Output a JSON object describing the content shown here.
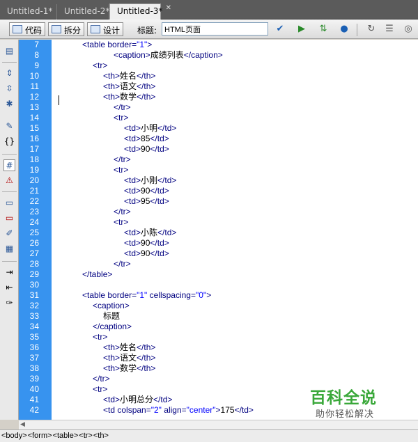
{
  "tabs": [
    {
      "label": "Untitled-1*"
    },
    {
      "label": "Untitled-2*"
    },
    {
      "label": "Untitled-3*"
    }
  ],
  "toolbar": {
    "code_label": "代码",
    "split_label": "拆分",
    "design_label": "设计",
    "title_label": "标题:",
    "title_value": "HTML页面"
  },
  "editor": {
    "line_numbers": [
      "7",
      "8",
      "9",
      "10",
      "11",
      "12",
      "13",
      "14",
      "15",
      "16",
      "17",
      "18",
      "19",
      "20",
      "21",
      "22",
      "23",
      "24",
      "25",
      "26",
      "27",
      "28",
      "29",
      "30",
      "31",
      "32",
      "33",
      "34",
      "35",
      "36",
      "37",
      "38",
      "39",
      "40",
      "41",
      "42"
    ],
    "lines": [
      {
        "indent": 3,
        "tokens": [
          [
            "tag",
            "<table "
          ],
          [
            "attr",
            "border="
          ],
          [
            "val",
            "\"1\""
          ],
          [
            "tag",
            ">"
          ]
        ]
      },
      {
        "indent": 6,
        "tokens": [
          [
            "tag",
            "<caption>"
          ],
          [
            "txt",
            "成绩列表"
          ],
          [
            "tag",
            "</caption>"
          ]
        ]
      },
      {
        "indent": 4,
        "tokens": [
          [
            "tag",
            "<tr>"
          ]
        ]
      },
      {
        "indent": 5,
        "tokens": [
          [
            "tag",
            "<th>"
          ],
          [
            "txt",
            "姓名"
          ],
          [
            "tag",
            "</th>"
          ]
        ]
      },
      {
        "indent": 5,
        "tokens": [
          [
            "tag",
            "<th>"
          ],
          [
            "txt",
            "语文"
          ],
          [
            "tag",
            "</th>"
          ]
        ]
      },
      {
        "indent": 5,
        "tokens": [
          [
            "tag",
            "<th>"
          ],
          [
            "txt",
            "数学"
          ],
          [
            "tag",
            "</th>"
          ]
        ]
      },
      {
        "indent": 6,
        "tokens": [
          [
            "tag",
            "</tr>"
          ]
        ]
      },
      {
        "indent": 6,
        "tokens": [
          [
            "tag",
            "<tr>"
          ]
        ]
      },
      {
        "indent": 7,
        "tokens": [
          [
            "tag",
            "<td>"
          ],
          [
            "txt",
            "小明"
          ],
          [
            "tag",
            "</td>"
          ]
        ]
      },
      {
        "indent": 7,
        "tokens": [
          [
            "tag",
            "<td>"
          ],
          [
            "txt",
            "85"
          ],
          [
            "tag",
            "</td>"
          ]
        ]
      },
      {
        "indent": 7,
        "tokens": [
          [
            "tag",
            "<td>"
          ],
          [
            "txt",
            "90"
          ],
          [
            "tag",
            "</td>"
          ]
        ]
      },
      {
        "indent": 6,
        "tokens": [
          [
            "tag",
            "</tr>"
          ]
        ]
      },
      {
        "indent": 6,
        "tokens": [
          [
            "tag",
            "<tr>"
          ]
        ]
      },
      {
        "indent": 7,
        "tokens": [
          [
            "tag",
            "<td>"
          ],
          [
            "txt",
            "小刚"
          ],
          [
            "tag",
            "</td>"
          ]
        ]
      },
      {
        "indent": 7,
        "tokens": [
          [
            "tag",
            "<td>"
          ],
          [
            "txt",
            "90"
          ],
          [
            "tag",
            "</td>"
          ]
        ]
      },
      {
        "indent": 7,
        "tokens": [
          [
            "tag",
            "<td>"
          ],
          [
            "txt",
            "95"
          ],
          [
            "tag",
            "</td>"
          ]
        ]
      },
      {
        "indent": 6,
        "tokens": [
          [
            "tag",
            "</tr>"
          ]
        ]
      },
      {
        "indent": 6,
        "tokens": [
          [
            "tag",
            "<tr>"
          ]
        ]
      },
      {
        "indent": 7,
        "tokens": [
          [
            "tag",
            "<td>"
          ],
          [
            "txt",
            "小陈"
          ],
          [
            "tag",
            "</td>"
          ]
        ]
      },
      {
        "indent": 7,
        "tokens": [
          [
            "tag",
            "<td>"
          ],
          [
            "txt",
            "90"
          ],
          [
            "tag",
            "</td>"
          ]
        ]
      },
      {
        "indent": 7,
        "tokens": [
          [
            "tag",
            "<td>"
          ],
          [
            "txt",
            "90"
          ],
          [
            "tag",
            "</td>"
          ]
        ]
      },
      {
        "indent": 6,
        "tokens": [
          [
            "tag",
            "</tr>"
          ]
        ]
      },
      {
        "indent": 3,
        "tokens": [
          [
            "tag",
            "</table>"
          ]
        ]
      },
      {
        "indent": 0,
        "tokens": []
      },
      {
        "indent": 3,
        "tokens": [
          [
            "tag",
            "<table "
          ],
          [
            "attr",
            "border="
          ],
          [
            "val",
            "\"1\""
          ],
          [
            "attr",
            " cellspacing="
          ],
          [
            "val",
            "\"0\""
          ],
          [
            "tag",
            ">"
          ]
        ]
      },
      {
        "indent": 4,
        "tokens": [
          [
            "tag",
            "<caption>"
          ]
        ]
      },
      {
        "indent": 5,
        "tokens": [
          [
            "txt",
            "标题"
          ]
        ]
      },
      {
        "indent": 4,
        "tokens": [
          [
            "tag",
            "</caption>"
          ]
        ]
      },
      {
        "indent": 4,
        "tokens": [
          [
            "tag",
            "<tr>"
          ]
        ]
      },
      {
        "indent": 5,
        "tokens": [
          [
            "tag",
            "<th>"
          ],
          [
            "txt",
            "姓名"
          ],
          [
            "tag",
            "</th>"
          ]
        ]
      },
      {
        "indent": 5,
        "tokens": [
          [
            "tag",
            "<th>"
          ],
          [
            "txt",
            "语文"
          ],
          [
            "tag",
            "</th>"
          ]
        ]
      },
      {
        "indent": 5,
        "tokens": [
          [
            "tag",
            "<th>"
          ],
          [
            "txt",
            "数学"
          ],
          [
            "tag",
            "</th>"
          ]
        ]
      },
      {
        "indent": 4,
        "tokens": [
          [
            "tag",
            "</tr>"
          ]
        ]
      },
      {
        "indent": 4,
        "tokens": [
          [
            "tag",
            "<tr>"
          ]
        ]
      },
      {
        "indent": 5,
        "tokens": [
          [
            "tag",
            "<td>"
          ],
          [
            "txt",
            "小明总分"
          ],
          [
            "tag",
            "</td>"
          ]
        ]
      },
      {
        "indent": 5,
        "tokens": [
          [
            "tag",
            "<td "
          ],
          [
            "attr",
            "colspan="
          ],
          [
            "val",
            "\"2\""
          ],
          [
            "attr",
            " align="
          ],
          [
            "val",
            "\"center\""
          ],
          [
            "tag",
            ">"
          ],
          [
            "txt",
            "175"
          ],
          [
            "tag",
            "</td>"
          ]
        ]
      }
    ]
  },
  "status": {
    "crumbs": [
      "<body>",
      "<form>",
      "<table>",
      "<tr>",
      "<th>"
    ]
  },
  "watermark": {
    "title": "百科全说",
    "subtitle": "助你轻松解决"
  },
  "colors": {
    "gutter": "#3793ef",
    "tag": "#000080",
    "value": "#0000ff"
  }
}
